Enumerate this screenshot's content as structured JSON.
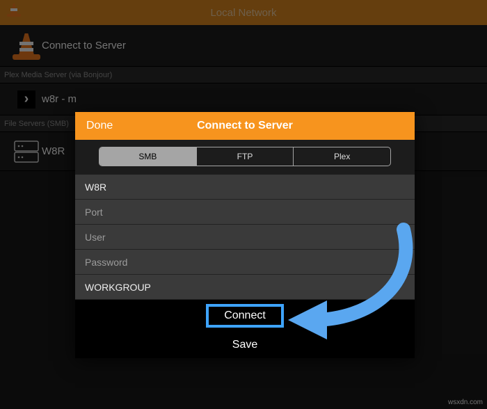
{
  "navbar": {
    "title": "Local Network"
  },
  "connectRow": {
    "label": "Connect to Server"
  },
  "sectionPlex": {
    "label": "Plex Media Server (via Bonjour)"
  },
  "plexRow": {
    "label": "w8r - m"
  },
  "sectionSmb": {
    "label": "File Servers (SMB)"
  },
  "smbRow": {
    "label": "W8R"
  },
  "dialog": {
    "done": "Done",
    "title": "Connect to Server",
    "seg": {
      "smb": "SMB",
      "ftp": "FTP",
      "plex": "Plex"
    },
    "fields": {
      "host": "W8R",
      "port": "Port",
      "user": "User",
      "password": "Password",
      "workgroup": "WORKGROUP"
    },
    "connect": "Connect",
    "save": "Save"
  },
  "watermark": "wsxdn.com"
}
